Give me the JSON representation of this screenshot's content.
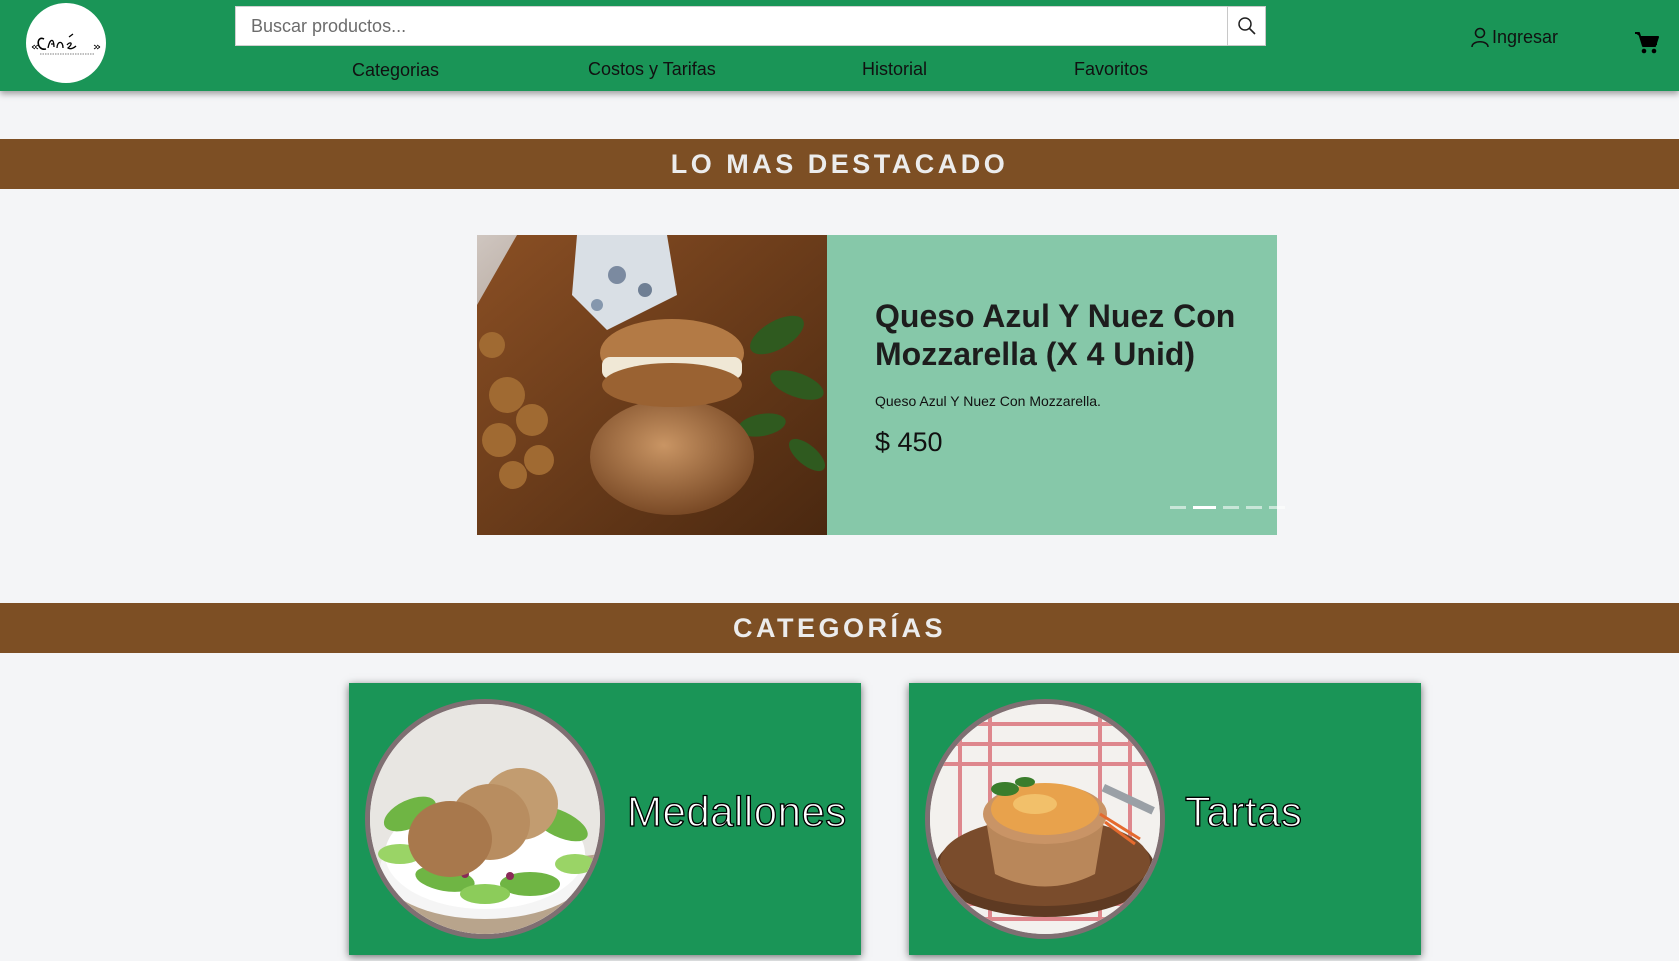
{
  "header": {
    "logo_alt": "Cané",
    "search": {
      "placeholder": "Buscar productos...",
      "value": ""
    },
    "nav": [
      {
        "label": "Categorias"
      },
      {
        "label": "Costos y Tarifas"
      },
      {
        "label": "Historial"
      },
      {
        "label": "Favoritos"
      }
    ],
    "login_label": "Ingresar",
    "icons": {
      "search": "search-icon",
      "user": "user-icon",
      "cart": "cart-icon"
    }
  },
  "featured": {
    "heading": "LO MAS DESTACADO",
    "slide": {
      "title": "Queso Azul Y Nuez Con Mozzarella (X 4 Unid)",
      "description": "Queso Azul Y Nuez Con Mozzarella.",
      "price": "$ 450"
    },
    "indicators_total": 5,
    "active_indicator": 2
  },
  "categories": {
    "heading": "CATEGORÍAS",
    "items": [
      {
        "label": "Medallones"
      },
      {
        "label": "Tartas"
      }
    ]
  },
  "colors": {
    "header_green": "#1a9557",
    "section_brown": "#7d4f24",
    "slide_panel": "#86c8a9",
    "background": "#f4f5f7"
  }
}
